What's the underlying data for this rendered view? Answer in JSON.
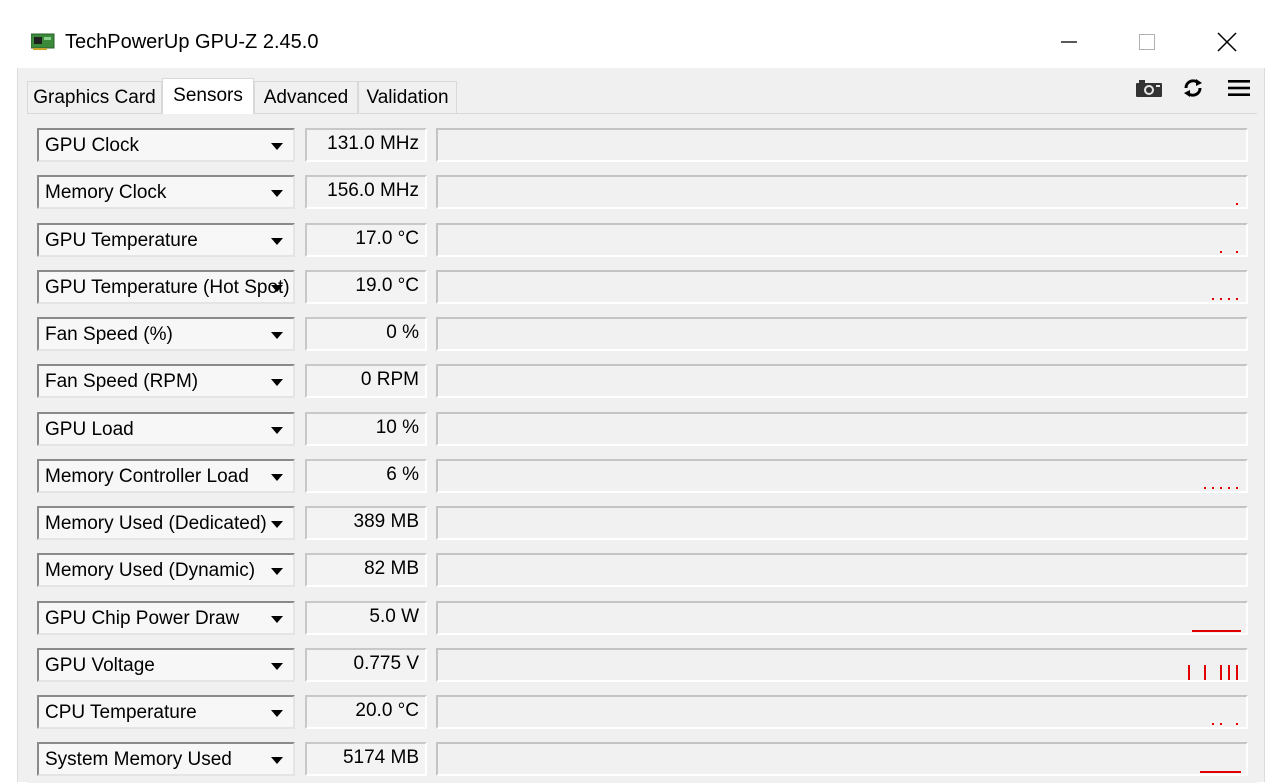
{
  "window": {
    "title": "TechPowerUp GPU-Z 2.45.0",
    "icon": "gpu-card-icon",
    "controls": [
      "minimize-icon",
      "maximize-icon",
      "close-icon"
    ]
  },
  "tabs": [
    {
      "label": "Graphics Card",
      "active": false
    },
    {
      "label": "Sensors",
      "active": true
    },
    {
      "label": "Advanced",
      "active": false
    },
    {
      "label": "Validation",
      "active": false
    }
  ],
  "toolbar": [
    "camera-icon",
    "refresh-icon",
    "menu-icon"
  ],
  "colors": {
    "graph_line": "#e00000",
    "panel_bg": "#f0f0f0"
  },
  "sensors": [
    {
      "label": "GPU Clock",
      "value": "131.0 MHz",
      "graph": [
        0,
        0,
        0
      ]
    },
    {
      "label": "Memory Clock",
      "value": "156.0 MHz",
      "graph": [
        0,
        0,
        0.05
      ]
    },
    {
      "label": "GPU Temperature",
      "value": "17.0 °C",
      "graph": [
        0.05,
        0,
        0.05
      ]
    },
    {
      "label": "GPU Temperature (Hot Spot)",
      "value": "19.0 °C",
      "graph": [
        0.05,
        0.05,
        0.05,
        0.05
      ]
    },
    {
      "label": "Fan Speed (%)",
      "value": "0 %",
      "graph": [
        0,
        0,
        0
      ]
    },
    {
      "label": "Fan Speed (RPM)",
      "value": "0 RPM",
      "graph": [
        0,
        0,
        0
      ]
    },
    {
      "label": "GPU Load",
      "value": "10 %",
      "graph": [
        0,
        0,
        0
      ]
    },
    {
      "label": "Memory Controller Load",
      "value": "6 %",
      "graph": [
        0.06,
        0.06,
        0.06,
        0.06,
        0.06
      ]
    },
    {
      "label": "Memory Used (Dedicated)",
      "value": "389 MB",
      "graph": [
        0,
        0,
        0
      ]
    },
    {
      "label": "Memory Used (Dynamic)",
      "value": "82 MB",
      "graph": [
        0,
        0,
        0
      ]
    },
    {
      "label": "GPU Chip Power Draw",
      "value": "5.0 W",
      "graph": [
        0.1,
        0.1,
        0.1,
        0.1,
        0.1,
        0.1
      ]
    },
    {
      "label": "GPU Voltage",
      "value": "0.775 V",
      "graph": [
        0.5,
        0,
        0.5,
        0,
        0.5,
        0.5,
        0.5
      ]
    },
    {
      "label": "CPU Temperature",
      "value": "20.0 °C",
      "graph": [
        0.05,
        0.05,
        0,
        0.05
      ]
    },
    {
      "label": "System Memory Used",
      "value": "5174 MB",
      "graph": [
        0.1,
        0.1,
        0.1,
        0.1,
        0.1
      ]
    }
  ]
}
